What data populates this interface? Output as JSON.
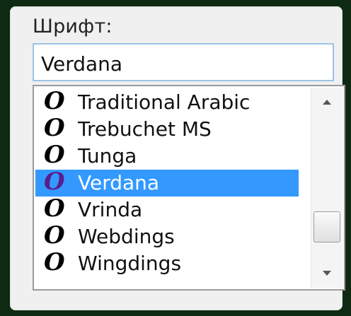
{
  "font_dialog": {
    "label": "Шрифт:",
    "input_value": "Verdana",
    "glyph": "O",
    "items": [
      {
        "name": "Traditional Arabic",
        "selected": false
      },
      {
        "name": "Trebuchet MS",
        "selected": false
      },
      {
        "name": "Tunga",
        "selected": false
      },
      {
        "name": "Verdana",
        "selected": true
      },
      {
        "name": "Vrinda",
        "selected": false
      },
      {
        "name": "Webdings",
        "selected": false
      },
      {
        "name": "Wingdings",
        "selected": false
      }
    ],
    "scrollbar": {
      "position_fraction": 0.85
    },
    "colors": {
      "selection": "#3399ff",
      "selected_glyph": "#5a1d8c",
      "input_border": "#9cc3e6",
      "background": "#0f2a12"
    },
    "icons": {
      "font_type_glyph": "opentype-font-icon",
      "scroll_up": "arrow-up-icon",
      "scroll_down": "arrow-down-icon"
    }
  }
}
